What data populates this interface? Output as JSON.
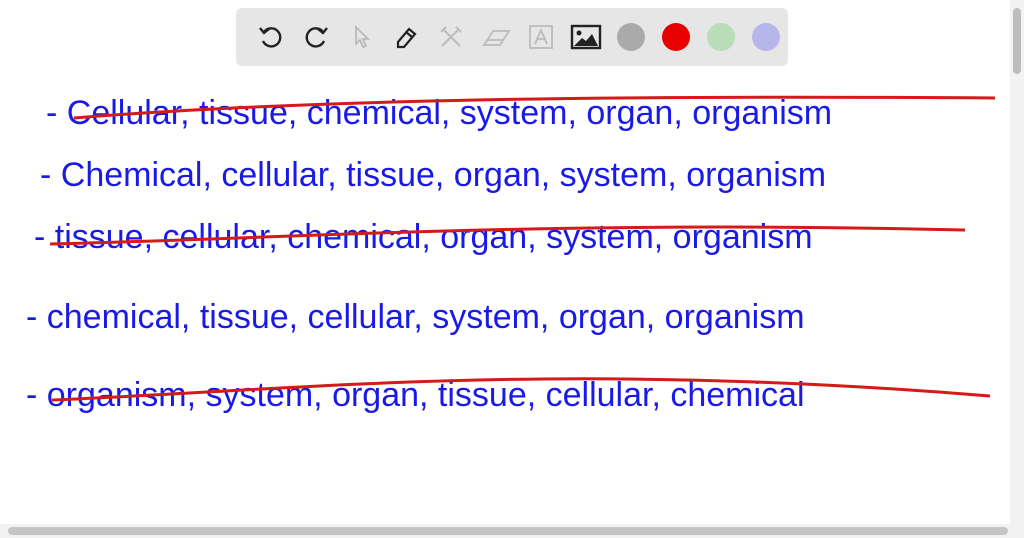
{
  "toolbar": {
    "tools": [
      "undo-icon",
      "redo-icon",
      "select-icon",
      "pen-icon",
      "tools-icon",
      "eraser-icon",
      "text-icon",
      "image-icon"
    ],
    "colors": [
      "#aaaaaa",
      "#e60000",
      "#b9dcb9",
      "#b6b6ea"
    ]
  },
  "canvas": {
    "lines": [
      {
        "text": "- Cellular, tissue, chemical, system, organ, organism",
        "struck": true
      },
      {
        "text": "- Chemical, cellular, tissue, organ, system, organism",
        "struck": false
      },
      {
        "text": "- tissue, cellular, chemical, organ, system, organism",
        "struck": true
      },
      {
        "text": "- chemical, tissue, cellular, system, organ, organism",
        "struck": false
      },
      {
        "text": "- organism, system, organ, tissue, cellular, chemical",
        "struck": true
      }
    ],
    "ink_color": "#1a1ae6",
    "strike_color": "#d41a1a"
  }
}
